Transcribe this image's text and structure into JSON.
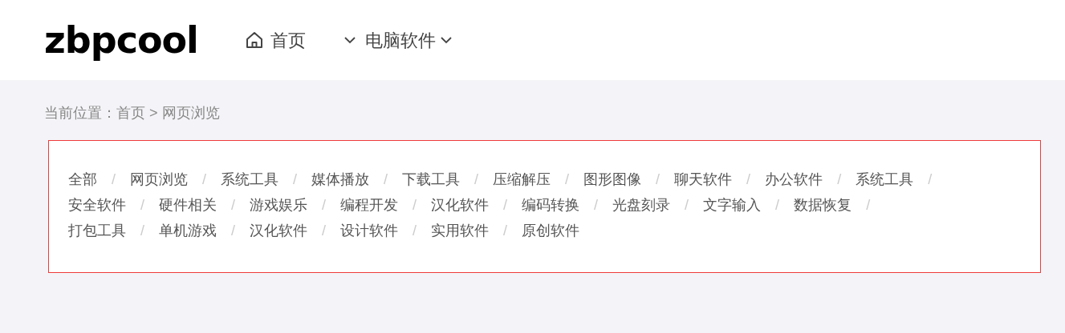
{
  "header": {
    "logo": "zbpcool",
    "nav": [
      {
        "label": "首页",
        "kind": "home"
      },
      {
        "label": "电脑软件",
        "kind": "dropdown"
      }
    ]
  },
  "breadcrumb": {
    "label": "当前位置：",
    "items": [
      "首页",
      "网页浏览"
    ],
    "separator": ">"
  },
  "category_rows": [
    [
      {
        "label": "全部",
        "separator": "/"
      },
      {
        "label": "网页浏览",
        "separator": "/"
      },
      {
        "label": "系统工具",
        "separator": "/"
      },
      {
        "label": "媒体播放",
        "separator": "/"
      },
      {
        "label": "下载工具",
        "separator": "/"
      },
      {
        "label": "压缩解压",
        "separator": "/"
      },
      {
        "label": "图形图像",
        "separator": "/"
      },
      {
        "label": "聊天软件",
        "separator": "/"
      },
      {
        "label": "办公软件",
        "separator": "/"
      },
      {
        "label": "系统工具",
        "separator": "/"
      }
    ],
    [
      {
        "label": "安全软件",
        "separator": "/"
      },
      {
        "label": "硬件相关",
        "separator": "/"
      },
      {
        "label": "游戏娱乐",
        "separator": "/"
      },
      {
        "label": "编程开发",
        "separator": "/"
      },
      {
        "label": "汉化软件",
        "separator": "/"
      },
      {
        "label": "编码转换",
        "separator": "/"
      },
      {
        "label": "光盘刻录",
        "separator": "/"
      },
      {
        "label": "文字输入",
        "separator": "/"
      },
      {
        "label": "数据恢复",
        "separator": "/"
      }
    ],
    [
      {
        "label": "打包工具",
        "separator": "/"
      },
      {
        "label": "单机游戏",
        "separator": "/"
      },
      {
        "label": "汉化软件",
        "separator": "/"
      },
      {
        "label": "设计软件",
        "separator": "/"
      },
      {
        "label": "实用软件",
        "separator": "/"
      },
      {
        "label": "原创软件"
      }
    ]
  ]
}
